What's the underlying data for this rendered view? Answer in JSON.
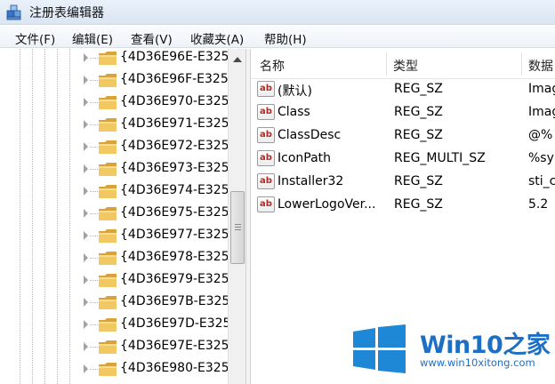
{
  "window": {
    "title": "注册表编辑器"
  },
  "menu": [
    "文件(F)",
    "编辑(E)",
    "查看(V)",
    "收藏夹(A)",
    "帮助(H)"
  ],
  "tree": {
    "items": [
      "{4D36E96E-E325",
      "{4D36E96F-E325",
      "{4D36E970-E325",
      "{4D36E971-E325",
      "{4D36E972-E325",
      "{4D36E973-E325",
      "{4D36E974-E325",
      "{4D36E975-E325",
      "{4D36E977-E325",
      "{4D36E978-E325",
      "{4D36E979-E325",
      "{4D36E97B-E325",
      "{4D36E97D-E325",
      "{4D36E97E-E325",
      "{4D36E980-E325"
    ]
  },
  "list": {
    "headers": {
      "name": "名称",
      "type": "类型",
      "data": "数据"
    },
    "rows": [
      {
        "name": "(默认)",
        "type": "REG_SZ",
        "data": "Imag"
      },
      {
        "name": "Class",
        "type": "REG_SZ",
        "data": "Imag"
      },
      {
        "name": "ClassDesc",
        "type": "REG_SZ",
        "data": "@%"
      },
      {
        "name": "IconPath",
        "type": "REG_MULTI_SZ",
        "data": "%sy"
      },
      {
        "name": "Installer32",
        "type": "REG_SZ",
        "data": "sti_c"
      },
      {
        "name": "LowerLogoVer...",
        "type": "REG_SZ",
        "data": "5.2"
      }
    ],
    "value_icon_text": "ab"
  },
  "watermark": {
    "brand": "Win10",
    "brand_suffix": "之家",
    "url": "www.win10xitong.com"
  },
  "colors": {
    "accent": "#1d6fc5",
    "folder": "#e8b64a",
    "reg_icon_text": "#b8271c"
  }
}
